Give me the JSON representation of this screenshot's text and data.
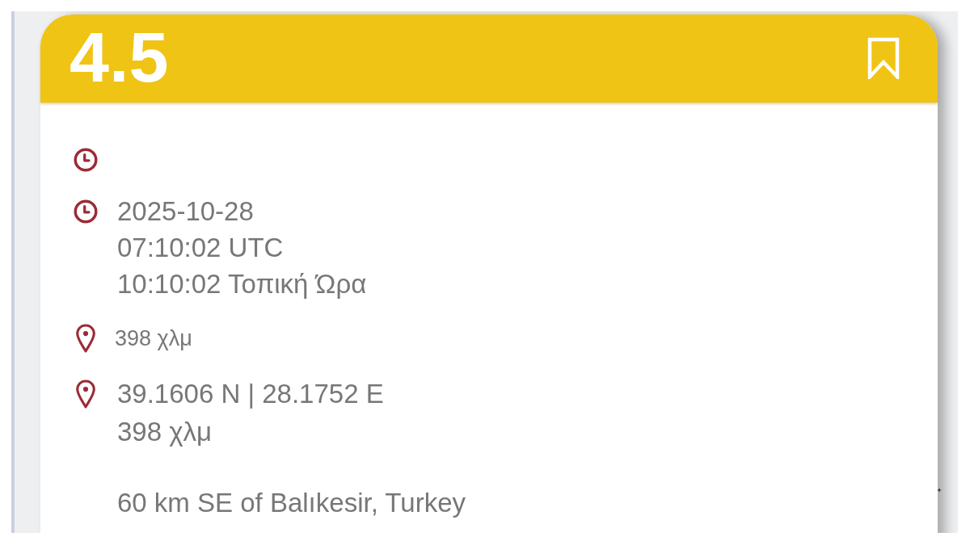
{
  "card": {
    "magnitude": "4.5",
    "bookmarked": false,
    "details": [
      {
        "kind": "time"
      },
      {
        "kind": "time",
        "lines": [
          "2025-10-28",
          "07:10:02 UTC",
          "10:10:02 Τοπική Ώρα"
        ]
      },
      {
        "kind": "distance",
        "lines": [
          "398 χλμ"
        ]
      },
      {
        "kind": "location",
        "lines": [
          "39.1606 N | 28.1752 E",
          "398 χλμ"
        ],
        "note": "60 km SE of Balıkesir, Turkey"
      }
    ]
  }
}
